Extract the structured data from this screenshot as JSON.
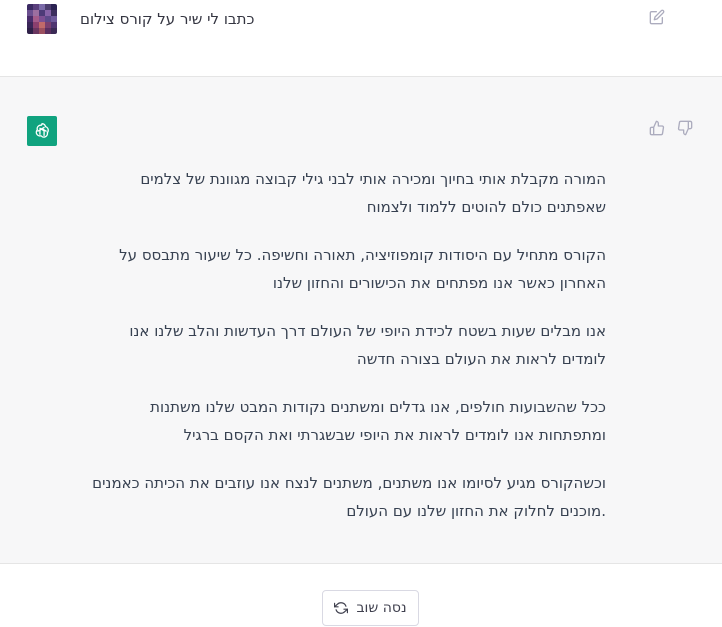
{
  "user_message": {
    "text": "כתבו לי שיר על קורס צילום"
  },
  "assistant_message": {
    "paragraphs": [
      {
        "lines": [
          "המורה מקבלת אותי בחיוך ומכירה אותי לבני גילי קבוצה מגוונת של צלמים",
          "שאפתנים כולם להוטים ללמוד ולצמוח"
        ]
      },
      {
        "lines": [
          "הקורס מתחיל עם היסודות קומפוזיציה, תאורה וחשיפה. כל שיעור מתבסס על",
          "האחרון כאשר אנו מפתחים את הכישורים והחזון שלנו"
        ]
      },
      {
        "lines": [
          "אנו מבלים שעות בשטח לכידת היופי של העולם דרך העדשות והלב שלנו אנו",
          "לומדים לראות את העולם בצורה חדשה"
        ]
      },
      {
        "lines": [
          "ככל שהשבועות חולפים, אנו גדלים ומשתנים נקודות המבט שלנו משתנות",
          "ומתפתחות אנו לומדים לראות את היופי שבשגרתי ואת הקסם ברגיל"
        ]
      },
      {
        "lines": [
          "וכשהקורס מגיע לסיומו אנו משתנים, משתנים לנצח אנו עוזבים את הכיתה כאמנים",
          ".מוכנים לחלוק את החזון שלנו עם העולם"
        ]
      }
    ]
  },
  "controls": {
    "retry_label": "נסה שוב"
  },
  "icons": {
    "edit": "edit-icon",
    "thumbs_up": "thumbs-up-icon",
    "thumbs_down": "thumbs-down-icon",
    "retry": "refresh-icon",
    "assistant_logo": "openai-logo-icon"
  },
  "colors": {
    "assistant_logo_bg": "#10a37f",
    "assistant_row_bg": "#f7f7f8"
  }
}
